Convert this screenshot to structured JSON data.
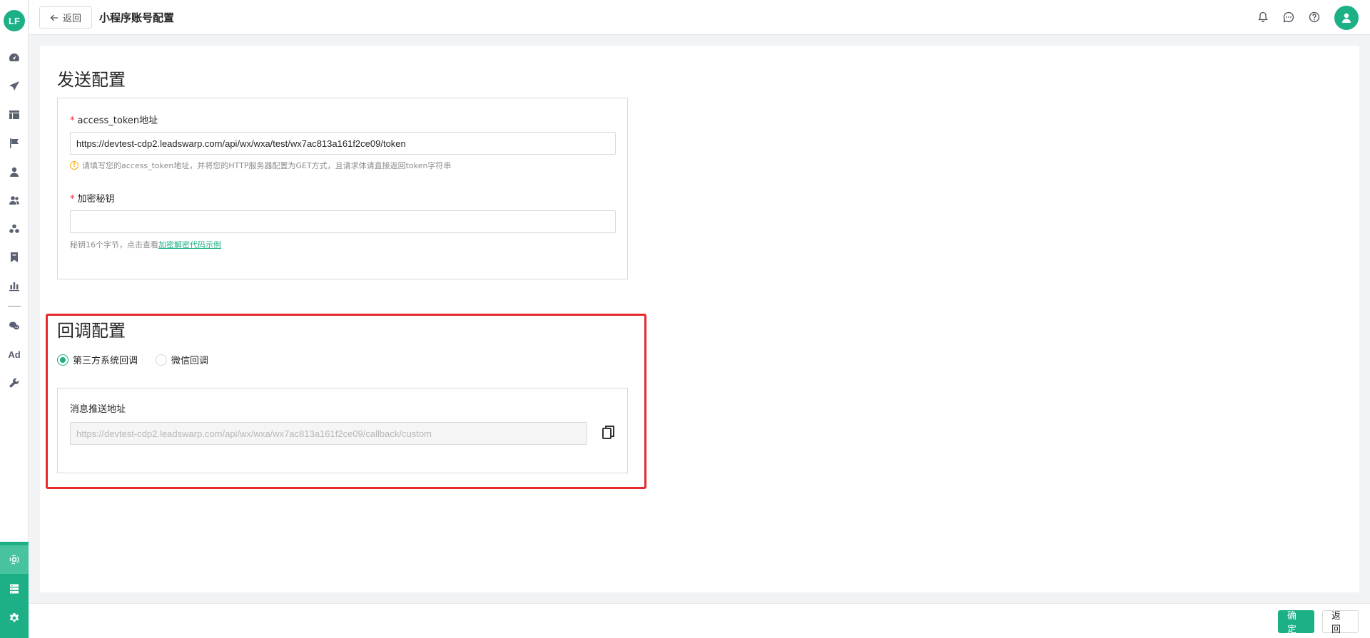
{
  "logo": {
    "text": "LF"
  },
  "sidebar": {
    "icons": [
      "dashboard-icon",
      "send-icon",
      "layout-icon",
      "flag-icon",
      "user-icon",
      "users-icon",
      "group-icon",
      "bookmark-icon",
      "bar-chart-icon",
      "wechat-icon",
      "ad-icon",
      "wrench-icon"
    ],
    "ad_label": "Ad",
    "bottom_icons": [
      "app-hub-icon",
      "server-icon",
      "settings-icon"
    ]
  },
  "header": {
    "back_label": "返回",
    "title": "小程序账号配置",
    "icons": [
      "bell-icon",
      "chat-icon",
      "help-icon",
      "avatar-icon"
    ]
  },
  "send_config": {
    "title": "发送配置",
    "access_token": {
      "label": "access_token地址",
      "value": "https://devtest-cdp2.leadswarp.com/api/wx/wxa/test/wx7ac813a161f2ce09/token",
      "hint": "请填写您的access_token地址，并将您的HTTP服务器配置为GET方式，且请求体请直接返回token字符串"
    },
    "secret": {
      "label": "加密秘钥",
      "value": "",
      "hint_prefix": "秘钥16个字节，点击查看",
      "hint_link": "加密解密代码示例"
    }
  },
  "callback_config": {
    "title": "回调配置",
    "options": [
      {
        "label": "第三方系统回调",
        "checked": true
      },
      {
        "label": "微信回调",
        "checked": false
      }
    ],
    "push_url": {
      "label": "消息推送地址",
      "placeholder": "https://devtest-cdp2.leadswarp.com/api/wx/wxa/wx7ac813a161f2ce09/callback/custom"
    }
  },
  "footer": {
    "confirm_label": "确定",
    "back_label": "返回"
  },
  "colors": {
    "accent": "#1db087",
    "highlight": "#e52b2b",
    "required": "#f5222d",
    "warning": "#faad14"
  }
}
